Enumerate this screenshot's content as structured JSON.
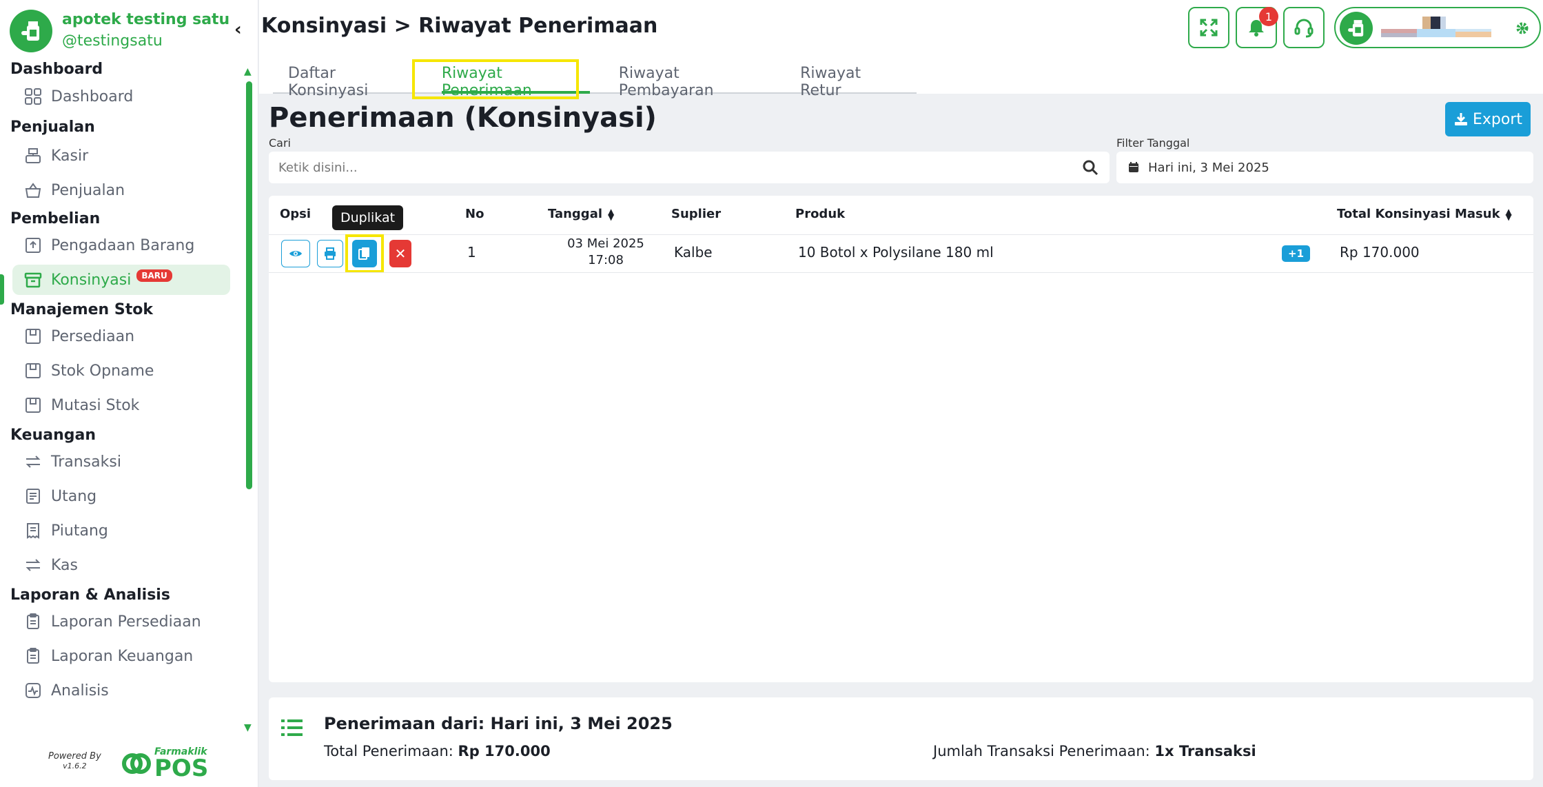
{
  "brand": {
    "name": "apotek testing satu",
    "handle": "@testingsatu"
  },
  "sidebar": {
    "sections": [
      {
        "title": "Dashboard",
        "items": [
          {
            "label": "Dashboard",
            "icon": "grid-icon"
          }
        ]
      },
      {
        "title": "Penjualan",
        "items": [
          {
            "label": "Kasir",
            "icon": "cash-register-icon"
          },
          {
            "label": "Penjualan",
            "icon": "basket-icon"
          }
        ]
      },
      {
        "title": "Pembelian",
        "items": [
          {
            "label": "Pengadaan Barang",
            "icon": "box-upload-icon"
          },
          {
            "label": "Konsinyasi",
            "icon": "archive-icon",
            "active": true,
            "badge": "BARU"
          }
        ]
      },
      {
        "title": "Manajemen Stok",
        "items": [
          {
            "label": "Persediaan",
            "icon": "storage-icon"
          },
          {
            "label": "Stok Opname",
            "icon": "storage-icon"
          },
          {
            "label": "Mutasi Stok",
            "icon": "storage-icon"
          }
        ]
      },
      {
        "title": "Keuangan",
        "items": [
          {
            "label": "Transaksi",
            "icon": "transfer-icon"
          },
          {
            "label": "Utang",
            "icon": "document-icon"
          },
          {
            "label": "Piutang",
            "icon": "receipt-icon"
          },
          {
            "label": "Kas",
            "icon": "transfer-icon"
          }
        ]
      },
      {
        "title": "Laporan & Analisis",
        "items": [
          {
            "label": "Laporan Persediaan",
            "icon": "clipboard-icon"
          },
          {
            "label": "Laporan Keuangan",
            "icon": "clipboard-icon"
          },
          {
            "label": "Analisis",
            "icon": "activity-icon"
          }
        ]
      }
    ],
    "powered_by": "Powered By",
    "version": "v1.6.2",
    "product_small": "Farmaklik",
    "product_big": "POS"
  },
  "header": {
    "title": "Konsinyasi > Riwayat Penerimaan",
    "notification_count": "1"
  },
  "tabs": [
    {
      "label": "Daftar Konsinyasi",
      "active": false
    },
    {
      "label": "Riwayat Penerimaan",
      "active": true
    },
    {
      "label": "Riwayat Pembayaran",
      "active": false
    },
    {
      "label": "Riwayat Retur",
      "active": false
    }
  ],
  "main": {
    "title": "Penerimaan (Konsinyasi)",
    "export_label": "Export",
    "search_label": "Cari",
    "search_placeholder": "Ketik disini...",
    "filter_label": "Filter Tanggal",
    "filter_value": "Hari ini, 3 Mei 2025"
  },
  "table": {
    "columns": {
      "opsi": "Opsi",
      "no": "No",
      "tanggal": "Tanggal",
      "suplier": "Suplier",
      "produk": "Produk",
      "total": "Total Konsinyasi Masuk"
    },
    "tooltip": "Duplikat",
    "rows": [
      {
        "no": "1",
        "date": "03 Mei 2025",
        "time": "17:08",
        "supplier": "Kalbe",
        "product": "10 Botol x Polysilane 180 ml",
        "more": "+1",
        "total": "Rp 170.000"
      }
    ]
  },
  "summary": {
    "title": "Penerimaan dari: Hari ini, 3 Mei 2025",
    "total_label": "Total Penerimaan:",
    "total_value": "Rp 170.000",
    "count_label": "Jumlah Transaksi Penerimaan:",
    "count_value": "1x Transaksi"
  },
  "colors": {
    "primary": "#2eaa4a",
    "accent": "#1a9ed8",
    "danger": "#e53935",
    "highlight": "#f6e600"
  }
}
